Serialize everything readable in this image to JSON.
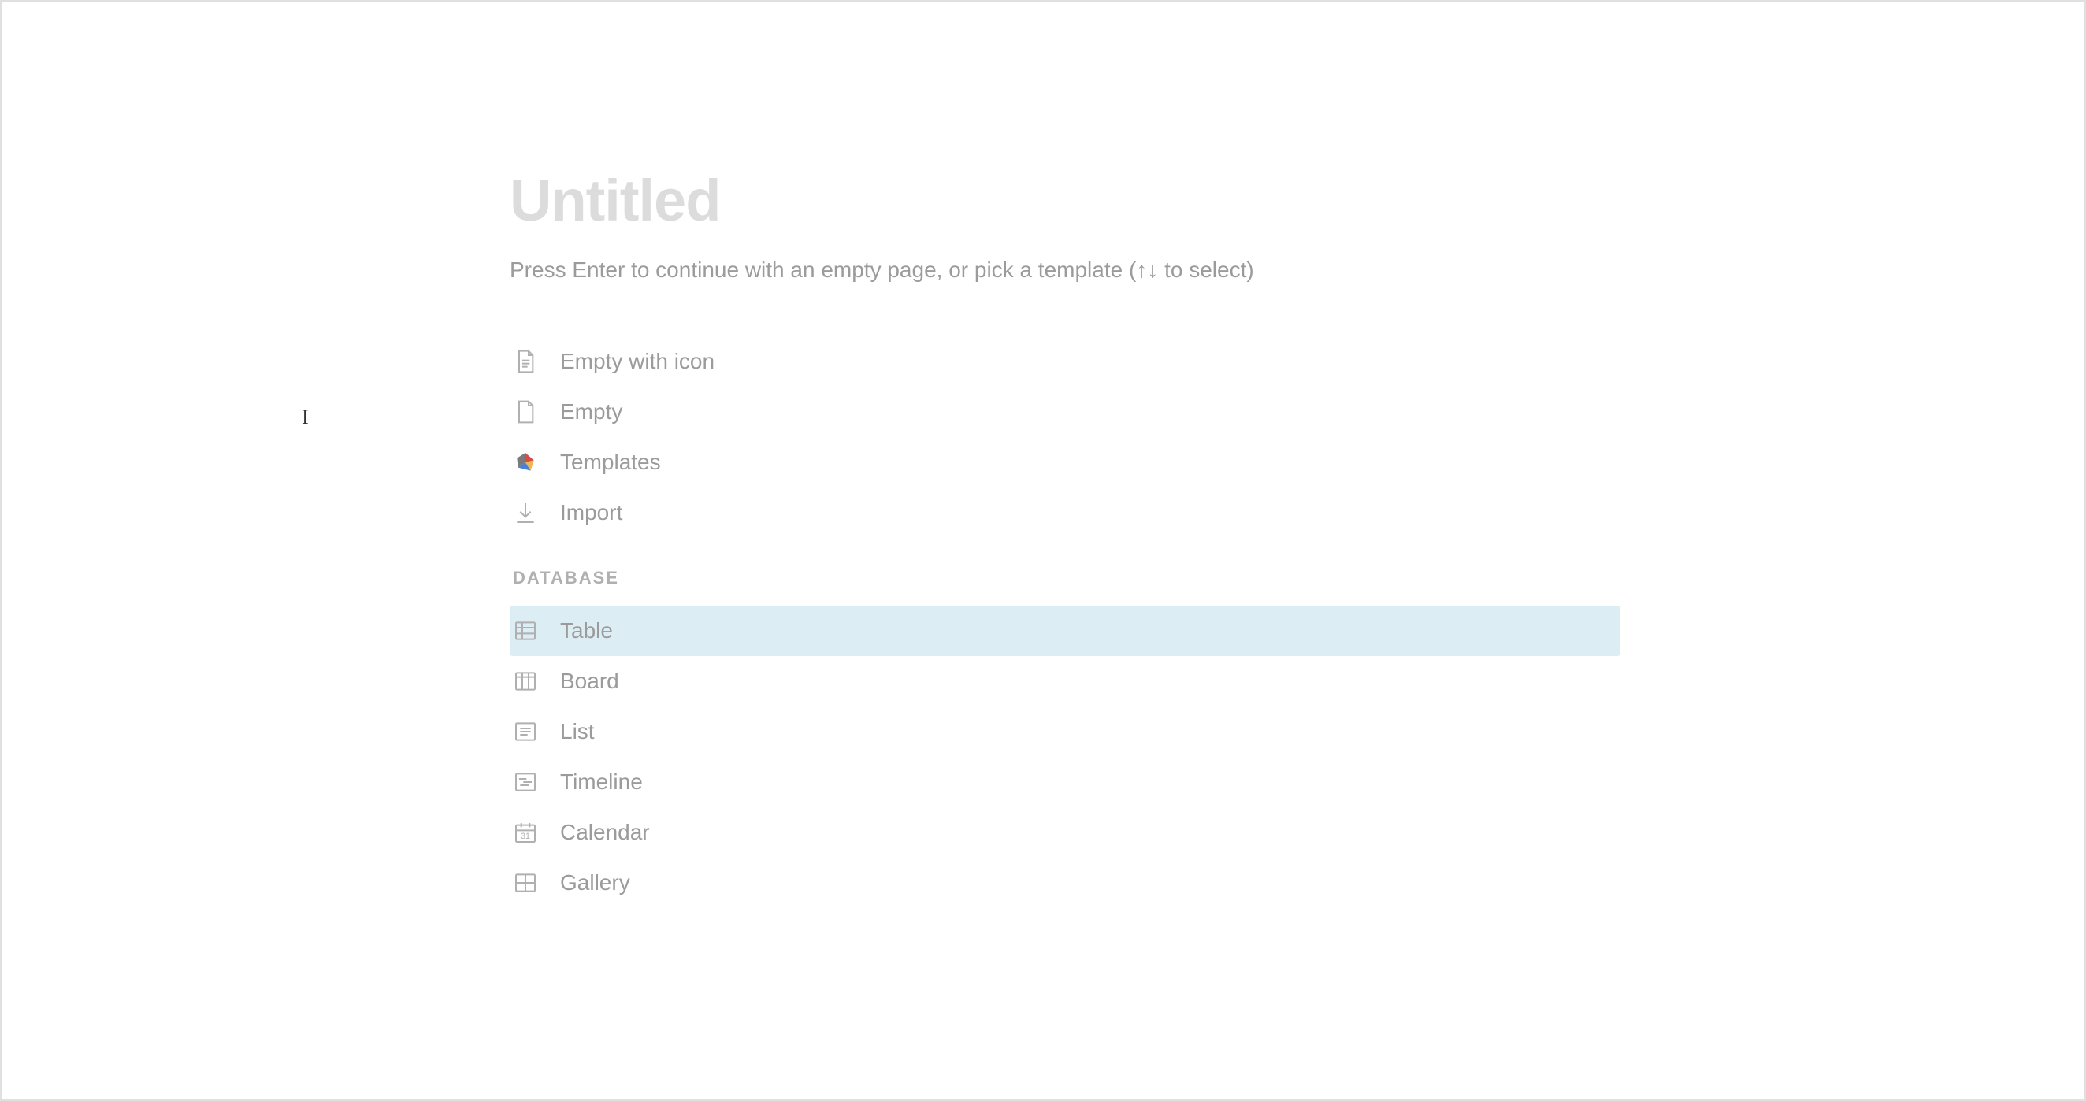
{
  "title": "Untitled",
  "hint": "Press Enter to continue with an empty page, or pick a template (↑↓ to select)",
  "cursor_char": "I",
  "section_header": "DATABASE",
  "options": {
    "empty_with_icon": {
      "label": "Empty with icon"
    },
    "empty": {
      "label": "Empty"
    },
    "templates": {
      "label": "Templates"
    },
    "import": {
      "label": "Import"
    }
  },
  "database_options": {
    "table": {
      "label": "Table",
      "highlighted": true
    },
    "board": {
      "label": "Board"
    },
    "list": {
      "label": "List"
    },
    "timeline": {
      "label": "Timeline"
    },
    "calendar": {
      "label": "Calendar"
    },
    "gallery": {
      "label": "Gallery"
    }
  }
}
